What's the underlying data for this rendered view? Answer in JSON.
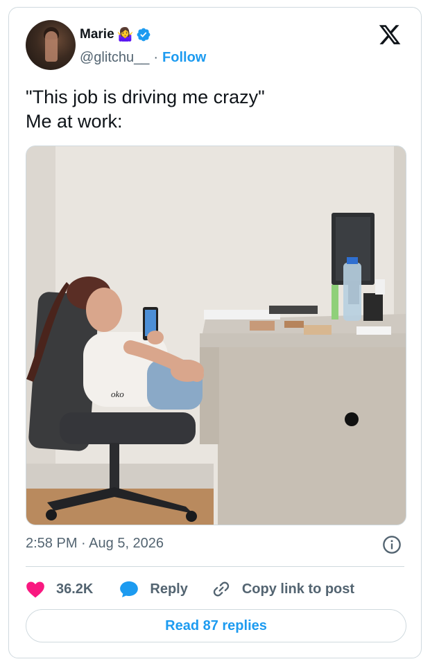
{
  "author": {
    "name": "Marie",
    "emoji": "🤷‍♀️",
    "handle": "@glitchu__",
    "separator": "·",
    "follow_label": "Follow"
  },
  "tweet": {
    "text": "\"This job is driving me crazy\"\nMe at work:"
  },
  "meta": {
    "time": "2:58 PM",
    "separator": "·",
    "date": "Aug 5, 2026"
  },
  "actions": {
    "likes": "36.2K",
    "reply_label": "Reply",
    "copy_label": "Copy link to post"
  },
  "read_replies_label": "Read 87 replies",
  "photo": {
    "shirt_text": "oko"
  },
  "colors": {
    "accent": "#1d9bf0",
    "like": "#f91880",
    "muted": "#536471",
    "border": "#cfd9de"
  },
  "icons": {
    "brand": "x-logo-icon",
    "verified": "verified-badge-icon",
    "info": "info-icon",
    "like": "heart-icon",
    "reply": "speech-bubble-icon",
    "copy": "link-icon"
  }
}
